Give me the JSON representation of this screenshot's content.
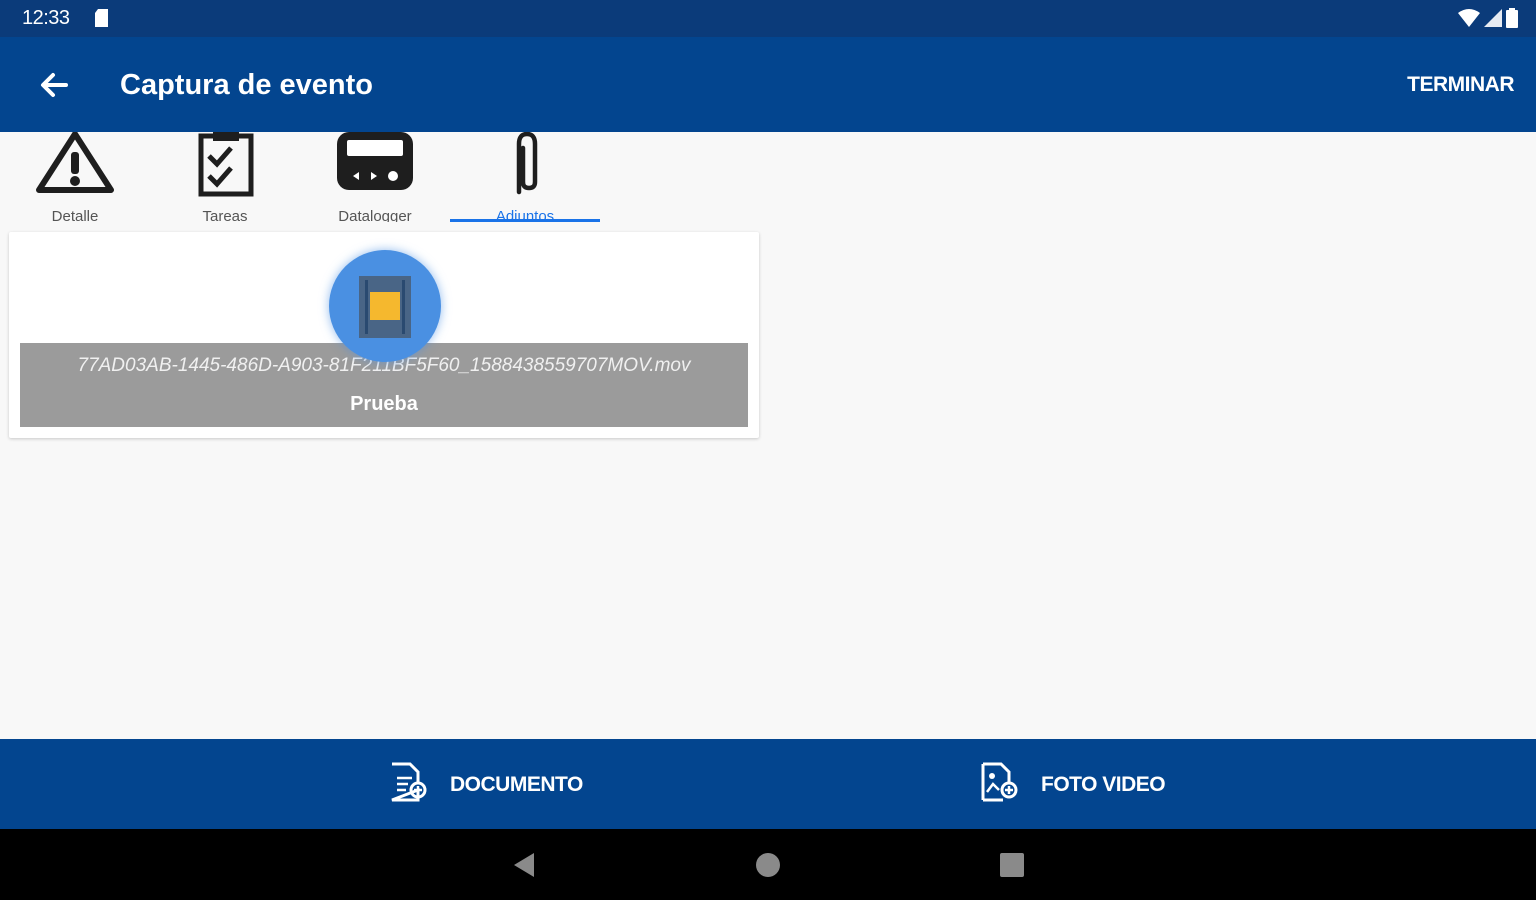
{
  "status_bar": {
    "time": "12:33",
    "icons": [
      "sd-card-icon",
      "wifi-icon",
      "signal-icon",
      "battery-icon"
    ]
  },
  "app_bar": {
    "title": "Captura de evento",
    "action_label": "TERMINAR"
  },
  "tabs": [
    {
      "label": "Detalle",
      "icon": "warning-icon",
      "active": false
    },
    {
      "label": "Tareas",
      "icon": "checklist-icon",
      "active": false
    },
    {
      "label": "Datalogger",
      "icon": "datalogger-icon",
      "active": false
    },
    {
      "label": "Adjuntos",
      "icon": "paperclip-icon",
      "active": true
    }
  ],
  "attachment": {
    "filename": "77AD03AB-1445-486D-A903-81F211BF5F60_1588438559707MOV.mov",
    "description": "Prueba",
    "icon": "film-icon"
  },
  "bottom_actions": [
    {
      "label": "DOCUMENTO",
      "icon": "document-add-icon"
    },
    {
      "label": "FOTO VIDEO",
      "icon": "photo-add-icon"
    }
  ],
  "colors": {
    "status_bar": "#0b3b7a",
    "app_bar": "#03458f",
    "accent": "#1a73e8",
    "caption_bg": "#9b9b9b",
    "thumb": "#4a90e2",
    "film": "#f5b82e"
  }
}
